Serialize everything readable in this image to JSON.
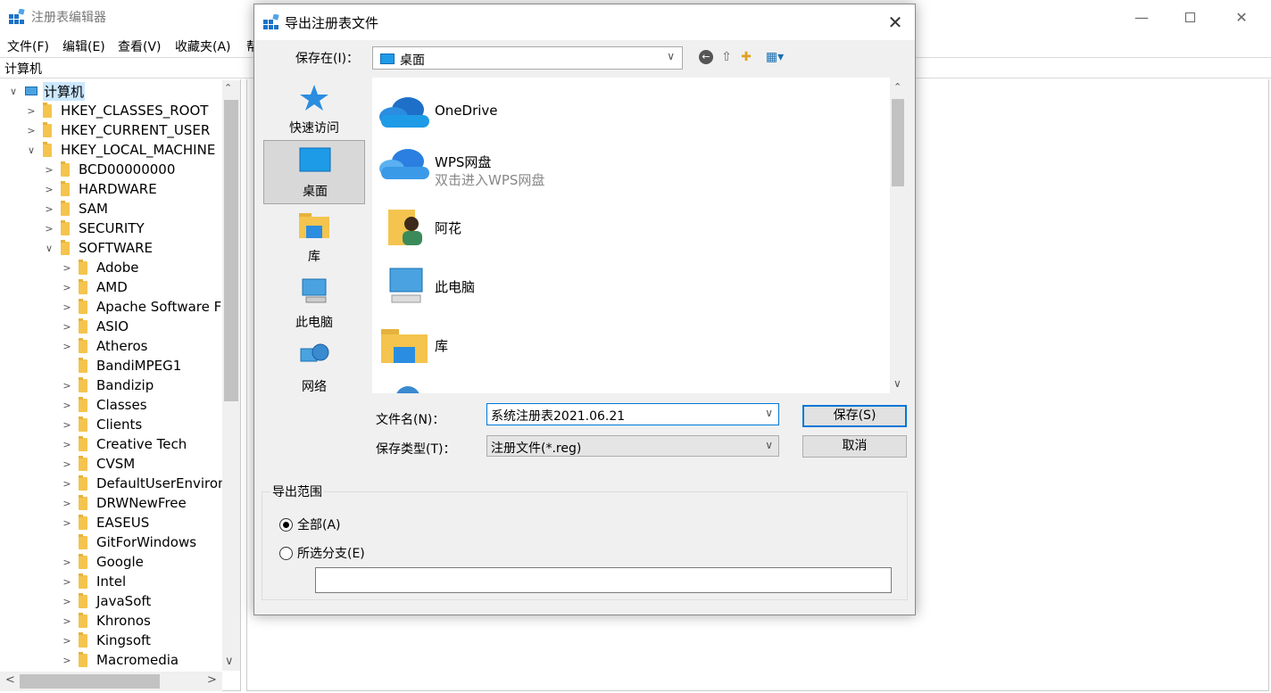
{
  "window": {
    "title": "注册表编辑器",
    "menu": [
      "文件(F)",
      "编辑(E)",
      "查看(V)",
      "收藏夹(A)",
      "帮"
    ],
    "address": "计算机"
  },
  "tree": {
    "root": "计算机",
    "hives": [
      "HKEY_CLASSES_ROOT",
      "HKEY_CURRENT_USER",
      "HKEY_LOCAL_MACHINE"
    ],
    "hklm_children": [
      "BCD00000000",
      "HARDWARE",
      "SAM",
      "SECURITY",
      "SOFTWARE"
    ],
    "software_children": [
      "Adobe",
      "AMD",
      "Apache Software F",
      "ASIO",
      "Atheros",
      "BandiMPEG1",
      "Bandizip",
      "Classes",
      "Clients",
      "Creative Tech",
      "CVSM",
      "DefaultUserEnviron",
      "DRWNewFree",
      "EASEUS",
      "GitForWindows",
      "Google",
      "Intel",
      "JavaSoft",
      "Khronos",
      "Kingsoft",
      "Macromedia"
    ]
  },
  "dialog": {
    "title": "导出注册表文件",
    "save_in_label": "保存在(I)：",
    "save_in_value": "桌面",
    "places": [
      "快速访问",
      "桌面",
      "库",
      "此电脑",
      "网络"
    ],
    "files": [
      {
        "name": "OneDrive",
        "sub": ""
      },
      {
        "name": "WPS网盘",
        "sub": "双击进入WPS网盘"
      },
      {
        "name": "阿花",
        "sub": ""
      },
      {
        "name": "此电脑",
        "sub": ""
      },
      {
        "name": "库",
        "sub": ""
      }
    ],
    "filename_label": "文件名(N)：",
    "filename_value": "系统注册表2021.06.21",
    "filetype_label": "保存类型(T)：",
    "filetype_value": "注册文件(*.reg)",
    "save_button": "保存(S)",
    "cancel_button": "取消",
    "range_title": "导出范围",
    "range_all": "全部(A)",
    "range_branch": "所选分支(E)",
    "branch_value": ""
  },
  "colors": {
    "accent": "#0078d7",
    "folder": "#f4c44e",
    "selected_place": "#d8d8d8"
  }
}
